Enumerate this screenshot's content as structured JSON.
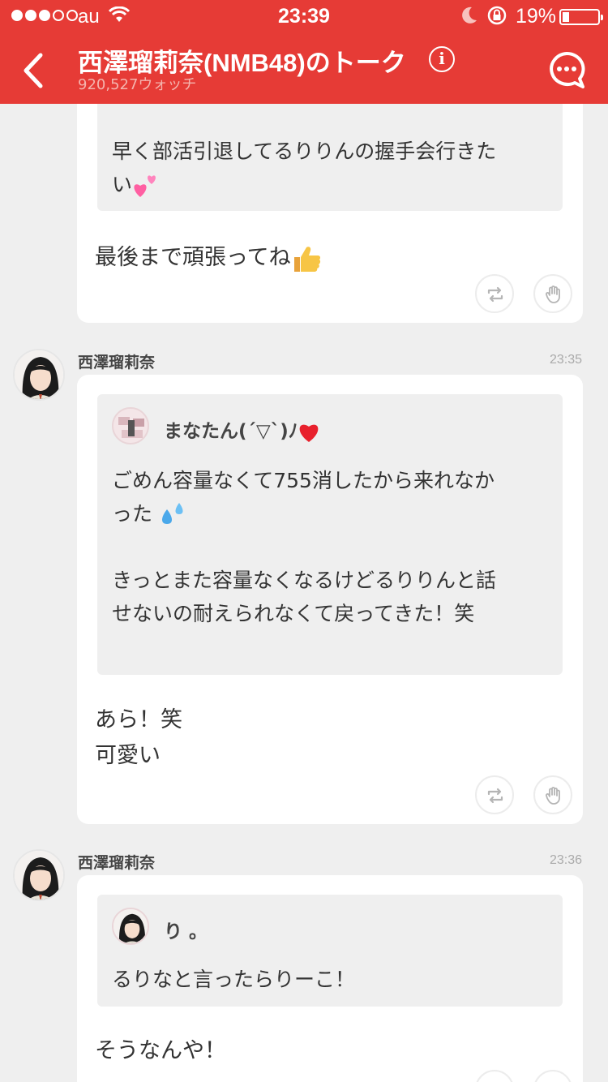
{
  "status_bar": {
    "carrier": "au",
    "time": "23:39",
    "battery": "19%",
    "battery_level": 0.19
  },
  "header": {
    "title": "西澤瑠莉奈(NMB48)のトーク",
    "watchers": "920,527ウォッチ",
    "info_label": "i"
  },
  "messages": [
    {
      "quote": {
        "text": "早く部活引退してるりりんの握手会行きた\nい"
      },
      "body": "最後まで頑張ってね"
    },
    {
      "sender": "西澤瑠莉奈",
      "time": "23:35",
      "quote": {
        "name": "まなたん(´▽`)ﾉ",
        "text": "ごめん容量なくて755消したから来れなか\nった\n\nきっとまた容量なくなるけどるりりんと話\nせないの耐えられなくて戻ってきた！笑"
      },
      "body": "あら！笑\n可愛い"
    },
    {
      "sender": "西澤瑠莉奈",
      "time": "23:36",
      "quote": {
        "name": "り 。",
        "text": "るりなと言ったらりーこ！"
      },
      "body": "そうなんや！"
    }
  ],
  "icons": {
    "repost": "repost-icon",
    "like": "hand-icon",
    "back": "chevron-left-icon",
    "talk": "speech-bubble-icon",
    "heart": "heart-emoji",
    "thumbs": "thumbs-up-emoji",
    "sweat": "sweat-drops-emoji",
    "hearts": "two-hearts-emoji"
  },
  "colors": {
    "brand_red": "#e63b36",
    "background": "#efefef",
    "quote_bg": "#efefef"
  }
}
